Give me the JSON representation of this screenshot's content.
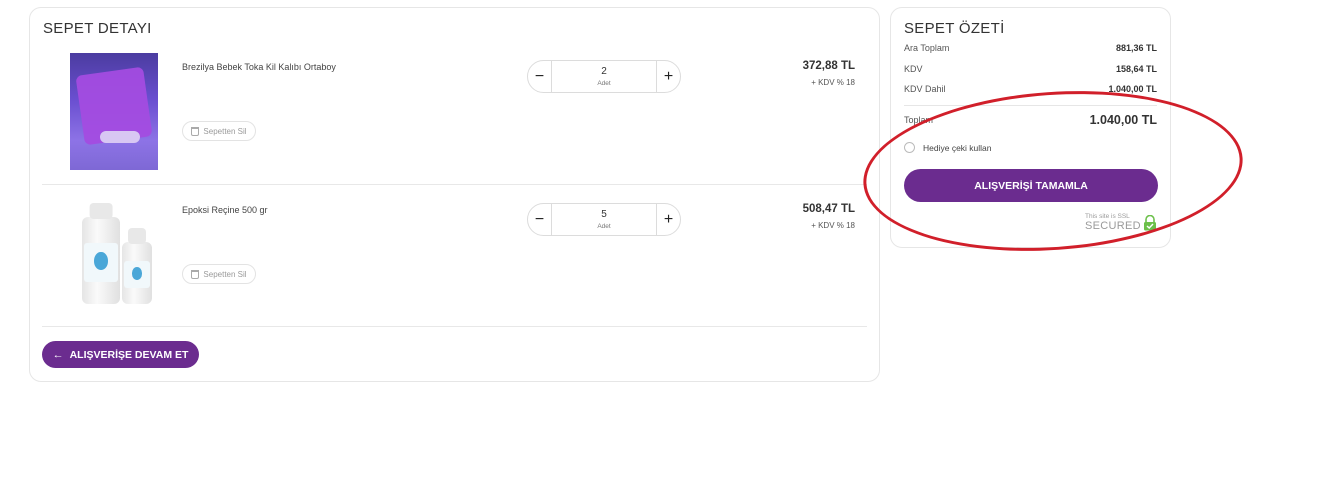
{
  "cart": {
    "title": "SEPET DETAYI",
    "remove_label": "Sepetten Sil",
    "unit_label": "Adet",
    "items": [
      {
        "name": "Brezilya Bebek Toka Kil Kalıbı Ortaboy",
        "quantity": "2",
        "price": "372,88 TL",
        "tax_note": "+ KDV % 18",
        "image": "purple-silicone-mold-photo"
      },
      {
        "name": "Epoksi Reçine 500 gr",
        "quantity": "5",
        "price": "508,47 TL",
        "tax_note": "+ KDV % 18",
        "image": "white-resin-bottles-photo"
      }
    ],
    "continue_label": "ALIŞVERİŞE DEVAM ET"
  },
  "summary": {
    "title": "SEPET ÖZETİ",
    "subtotal_label": "Ara Toplam",
    "subtotal_value": "881,36 TL",
    "kdv_label": "KDV",
    "kdv_value": "158,64 TL",
    "kdv_dahil_label": "KDV Dahil",
    "kdv_dahil_value": "1.040,00 TL",
    "total_label": "Toplam",
    "total_value": "1.040,00 TL",
    "gift_label": "Hediye çeki kullan",
    "checkout_label": "ALIŞVERİŞİ TAMAMLA",
    "ssl_small": "This site is SSL",
    "ssl_big": "SECURED"
  },
  "colors": {
    "brand": "#6b2c8f",
    "annotation": "#d11f2a",
    "ssl_lock": "#6cc04a"
  },
  "icons": {
    "minus": "−",
    "plus": "+",
    "back_arrow": "arrow-left-icon",
    "remove": "trash-icon",
    "ssl": "lock-icon"
  }
}
